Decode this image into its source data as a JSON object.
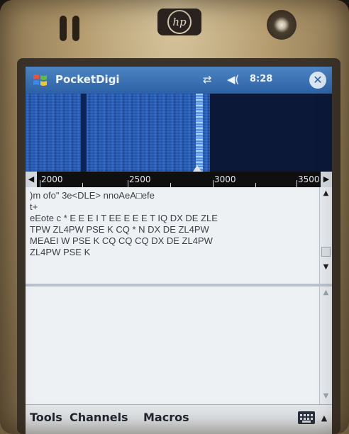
{
  "device": {
    "brand_logo": "hp"
  },
  "app": {
    "title": "PocketDigi",
    "clock": "8:28",
    "close_glyph": "✕",
    "connectivity_icon": "connectivity-icon",
    "volume_icon": "speaker-icon"
  },
  "spectrum": {
    "scale_labels": [
      "2000",
      "2500",
      "3000",
      "3500"
    ],
    "cursor_frequency": 2990
  },
  "receive": {
    "lines": [
      ")m ofo\" 3e<DLE> nnoAeA□efe",
      "t+",
      " eEote c * E E E I T EE E E E T IQ DX DE ZLE",
      "TPW ZL4PW PSE K CQ * N DX DE ZL4PW",
      "MEAEI W PSE K CQ CQ CQ DX DE ZL4PW",
      "ZL4PW PSE K"
    ]
  },
  "transmit": {
    "text": ""
  },
  "menu": {
    "items": [
      "Tools",
      "Channels",
      "Macros"
    ],
    "keyboard_icon": "keyboard-icon"
  },
  "colors": {
    "titlebar": "#2c62a5",
    "waterfall": "#0e1f48",
    "screen_bg": "#e9eef3"
  }
}
